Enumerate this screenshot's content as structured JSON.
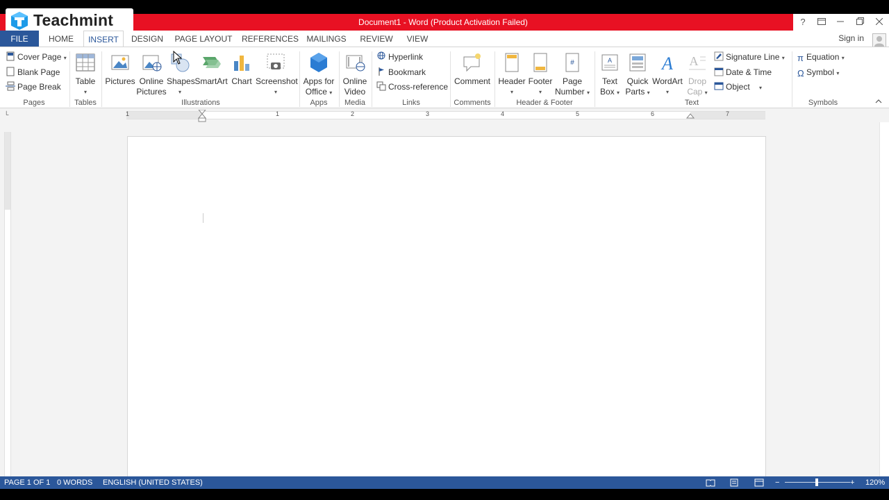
{
  "window": {
    "title": "Document1 - Word (Product Activation Failed)",
    "controls": [
      "?",
      "restore-ribbon",
      "minimize",
      "restore",
      "close"
    ]
  },
  "logo": {
    "text": "Teachmint"
  },
  "tabs": [
    {
      "label": "FILE"
    },
    {
      "label": "HOME"
    },
    {
      "label": "INSERT",
      "active": true
    },
    {
      "label": "DESIGN"
    },
    {
      "label": "PAGE LAYOUT"
    },
    {
      "label": "REFERENCES"
    },
    {
      "label": "MAILINGS"
    },
    {
      "label": "REVIEW"
    },
    {
      "label": "VIEW"
    }
  ],
  "account": {
    "sign_in": "Sign in"
  },
  "ribbon": {
    "pages": {
      "label": "Pages",
      "cover_page": "Cover Page",
      "blank_page": "Blank Page",
      "page_break": "Page Break"
    },
    "tables": {
      "label": "Tables",
      "table": "Table"
    },
    "illustrations": {
      "label": "Illustrations",
      "pictures": "Pictures",
      "online_pictures_1": "Online",
      "online_pictures_2": "Pictures",
      "shapes": "Shapes",
      "smartart": "SmartArt",
      "chart": "Chart",
      "screenshot": "Screenshot"
    },
    "apps": {
      "label": "Apps",
      "apps_1": "Apps for",
      "apps_2": "Office"
    },
    "media": {
      "label": "Media",
      "video_1": "Online",
      "video_2": "Video"
    },
    "links": {
      "label": "Links",
      "hyperlink": "Hyperlink",
      "bookmark": "Bookmark",
      "cross_reference": "Cross-reference"
    },
    "comments": {
      "label": "Comments",
      "comment": "Comment"
    },
    "header_footer": {
      "label": "Header & Footer",
      "header": "Header",
      "footer": "Footer",
      "page_number_1": "Page",
      "page_number_2": "Number"
    },
    "text": {
      "label": "Text",
      "text_box_1": "Text",
      "text_box_2": "Box",
      "quick_parts_1": "Quick",
      "quick_parts_2": "Parts",
      "wordart": "WordArt",
      "drop_cap_1": "Drop",
      "drop_cap_2": "Cap",
      "signature_line": "Signature Line",
      "date_time": "Date & Time",
      "object": "Object"
    },
    "symbols": {
      "label": "Symbols",
      "equation": "Equation",
      "symbol": "Symbol"
    }
  },
  "ruler": {
    "numbers": [
      "1",
      "1",
      "2",
      "3",
      "4",
      "5",
      "6",
      "7"
    ]
  },
  "status": {
    "page": "PAGE 1 OF 1",
    "words": "0 WORDS",
    "language": "ENGLISH (UNITED STATES)",
    "zoom": "120%"
  },
  "colors": {
    "word_blue": "#2b579a",
    "title_red": "#e81123"
  }
}
